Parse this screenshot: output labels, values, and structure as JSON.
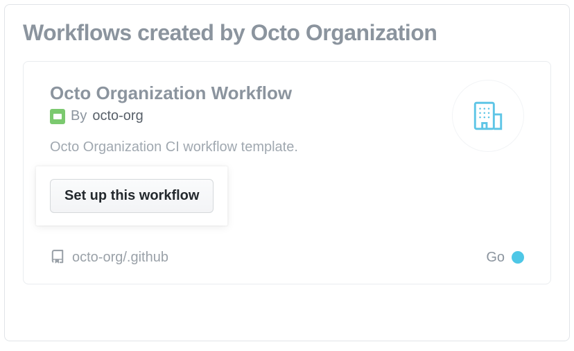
{
  "section": {
    "title": "Workflows created by Octo Organization"
  },
  "card": {
    "title": "Octo Organization Workflow",
    "by_label": "By",
    "author": "octo-org",
    "description": "Octo Organization CI workflow template.",
    "setup_button": "Set up this workflow",
    "repo": "octo-org/.github",
    "language": {
      "name": "Go",
      "color": "#4ec7e6"
    },
    "icon": "organization-icon"
  }
}
